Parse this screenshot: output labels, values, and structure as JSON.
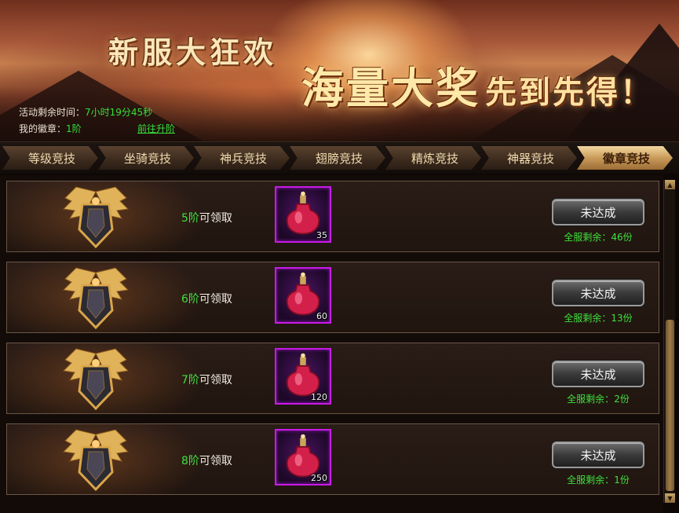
{
  "banner": {
    "title_main": "新服大狂欢",
    "title_big": "海量大奖",
    "title_small": "先到先得！",
    "time_label": "活动剩余时间：",
    "time_value": "7小时19分45秒",
    "badge_label": "我的徽章：",
    "badge_value": "1阶",
    "upgrade_link": "前往升阶"
  },
  "tabs": [
    {
      "label": "等级竞技",
      "active": false
    },
    {
      "label": "坐骑竞技",
      "active": false
    },
    {
      "label": "神兵竞技",
      "active": false
    },
    {
      "label": "翅膀竞技",
      "active": false
    },
    {
      "label": "精炼竞技",
      "active": false
    },
    {
      "label": "神器竞技",
      "active": false
    },
    {
      "label": "徽章竞技",
      "active": true
    }
  ],
  "rewards": [
    {
      "level": "5阶",
      "claim_text": "可领取",
      "item_qty": "35",
      "button": "未达成",
      "remain_label": "全服剩余：",
      "remain_value": "46份"
    },
    {
      "level": "6阶",
      "claim_text": "可领取",
      "item_qty": "60",
      "button": "未达成",
      "remain_label": "全服剩余：",
      "remain_value": "13份"
    },
    {
      "level": "7阶",
      "claim_text": "可领取",
      "item_qty": "120",
      "button": "未达成",
      "remain_label": "全服剩余：",
      "remain_value": "2份"
    },
    {
      "level": "8阶",
      "claim_text": "可领取",
      "item_qty": "250",
      "button": "未达成",
      "remain_label": "全服剩余：",
      "remain_value": "1份"
    }
  ],
  "icons": {
    "badge": "winged-badge-icon",
    "item": "red-potion-bottle-icon",
    "scroll_up": "triangle-up-icon",
    "scroll_down": "triangle-down-icon"
  },
  "colors": {
    "highlight_green": "#3fe040",
    "item_border_purple": "#c81ae6",
    "active_tab_gold": "#c99b5a"
  }
}
